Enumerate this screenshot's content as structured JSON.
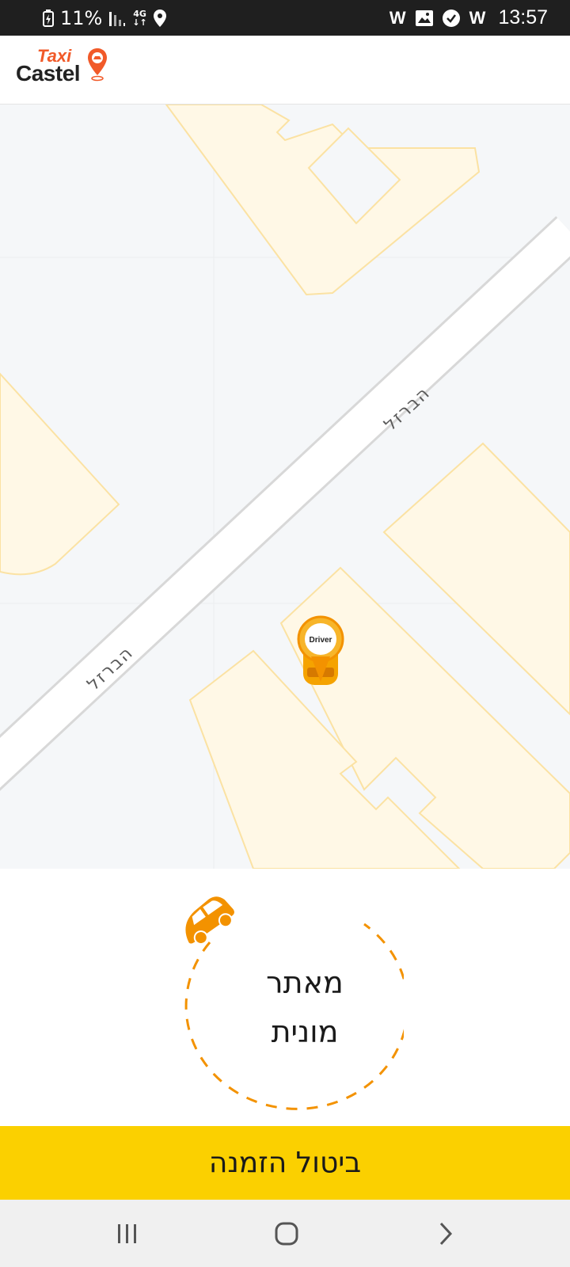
{
  "status_bar": {
    "battery": "11%",
    "network": "4G",
    "notification_icons": [
      "w-icon",
      "gallery-icon",
      "check-circle-icon",
      "w-icon"
    ],
    "w_label": "W",
    "time": "13:57"
  },
  "header": {
    "logo_top": "Taxi",
    "logo_main": "Castel"
  },
  "map": {
    "street_name": "הברזל",
    "driver_marker_label": "Driver",
    "colors": {
      "background": "#f5f7f9",
      "building_fill": "#fff8e6",
      "building_stroke": "#fbe2a3",
      "road": "#ffffff",
      "road_edge": "#dcdcdc"
    }
  },
  "status_panel": {
    "line1": "מאתר",
    "line2": "מונית",
    "accent_color": "#f39200"
  },
  "cancel_button": {
    "label": "ביטול הזמנה",
    "color": "#fbd000"
  },
  "nav_bar": {
    "buttons": [
      "recent-apps",
      "home",
      "back"
    ]
  }
}
